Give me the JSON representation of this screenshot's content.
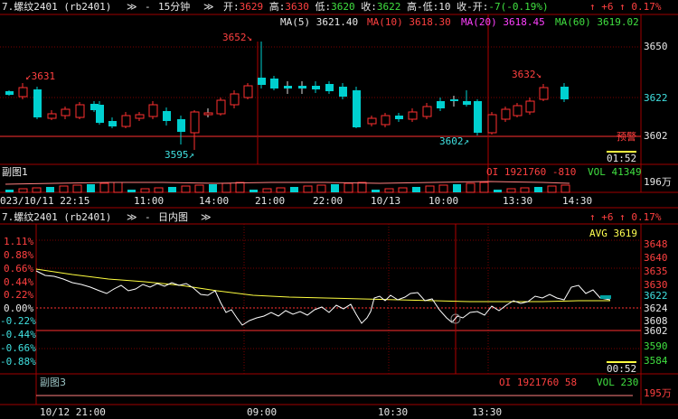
{
  "top_panel": {
    "title": "7.螺纹2401 (rb2401)",
    "chevrons": "≫",
    "dash": "-",
    "period": "15分钟",
    "chevron2": "≫",
    "open_label": "开:",
    "open": "3629",
    "high_label": "高:",
    "high": "3630",
    "low_label": "低:",
    "low": "3620",
    "close_label": "收:",
    "close": "3622",
    "hl_label": "高-低:",
    "hl": "10",
    "co_label": "收-开:",
    "co": "-7(-0.19%)",
    "corner_change": "↑ +6 ↑ 0.17%",
    "ma5": "MA(5) 3621.40",
    "ma10": "MA(10) 3618.30",
    "ma20": "MA(20) 3618.45",
    "ma60": "MA(60) 3619.02",
    "price_axis": [
      "3650",
      "3622",
      "3602"
    ],
    "annotations": {
      "a3652": "3652↘",
      "a3631": "↙3631",
      "a3632": "3632↘",
      "a3595": "3595↗",
      "a3602": "3602↗"
    },
    "alert_label": "预警",
    "countdown": "01:52"
  },
  "sub_chart1": {
    "label": "副图1",
    "oi": "OI 1921760 -810",
    "vol": "VOL 41349",
    "vol_axis": "196万"
  },
  "top_time_axis": [
    "023/10/11 22:15",
    "11:00",
    "14:00",
    "21:00",
    "22:00",
    "10/13",
    "10:00",
    "13:30",
    "14:30"
  ],
  "bottom_panel": {
    "title": "7.螺纹2401 (rb2401)",
    "chevrons": "≫",
    "dash": "-",
    "period": "日内图",
    "chevron2": "≫",
    "corner_change": "↑ +6 ↑ 0.17%",
    "avg": "AVG 3619",
    "pct_axis": [
      "1.11%",
      "0.88%",
      "0.66%",
      "0.44%",
      "0.22%",
      "0.00%",
      "-0.22%",
      "-0.44%",
      "-0.66%",
      "-0.88%"
    ],
    "price_axis": [
      "3648",
      "3640",
      "3635",
      "3630",
      "3624",
      "3622",
      "3608",
      "3602",
      "3590",
      "3584"
    ],
    "countdown": "00:52"
  },
  "sub_chart3": {
    "label": "副图3",
    "oi": "OI 1921760 58",
    "vol": "VOL 230",
    "vol_axis": "195万"
  },
  "bottom_time_axis": [
    "10/12 21:00",
    "09:00",
    "10:30",
    "13:30"
  ],
  "colors": {
    "up": "#ff3030",
    "down": "#00d0d0",
    "grid": "#7a0000",
    "frame": "#a00000",
    "price_line": "#ffffff",
    "avg_line": "#ffff40"
  }
}
